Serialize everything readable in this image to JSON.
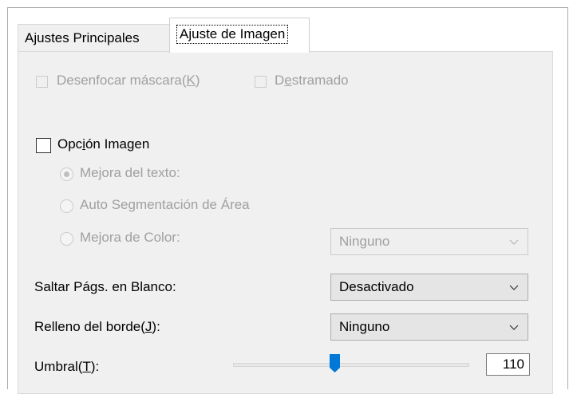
{
  "tabs": [
    {
      "label": "Ajustes Principales",
      "active": false
    },
    {
      "label": "Ajuste de Imagen",
      "active": true
    }
  ],
  "unsharp_mask": {
    "label_pre": "Desenfocar máscara(",
    "label_key": "K",
    "label_post": ")",
    "checked": false,
    "enabled": false
  },
  "descreening": {
    "label_pre": "D",
    "label_key": "e",
    "label_post": "stramado",
    "checked": false,
    "enabled": false
  },
  "image_option": {
    "label_pre": "Opc",
    "label_key": "i",
    "label_post": "ón Imagen",
    "checked": false,
    "enabled": true
  },
  "radios": [
    {
      "label": "Mejora del texto:",
      "selected": true,
      "enabled": false
    },
    {
      "label": "Auto Segmentación de Área",
      "selected": false,
      "enabled": false
    },
    {
      "label": "Mejora de Color:",
      "selected": false,
      "enabled": false
    }
  ],
  "color_enhance_select": {
    "value": "Ninguno",
    "enabled": false
  },
  "skip_blank": {
    "label": "Saltar Págs. en Blanco:",
    "value": "Desactivado"
  },
  "edge_fill": {
    "label_pre": "Relleno del borde(",
    "label_key": "J",
    "label_post": "):",
    "value": "Ninguno"
  },
  "threshold": {
    "label_pre": "Umbral(",
    "label_key": "T",
    "label_post": "):",
    "value": "110",
    "level": 110,
    "max": 255
  },
  "colors": {
    "accent": "#0078d7",
    "disabled_text": "#a0a0a0",
    "panel_bg": "#f0f0f0"
  }
}
